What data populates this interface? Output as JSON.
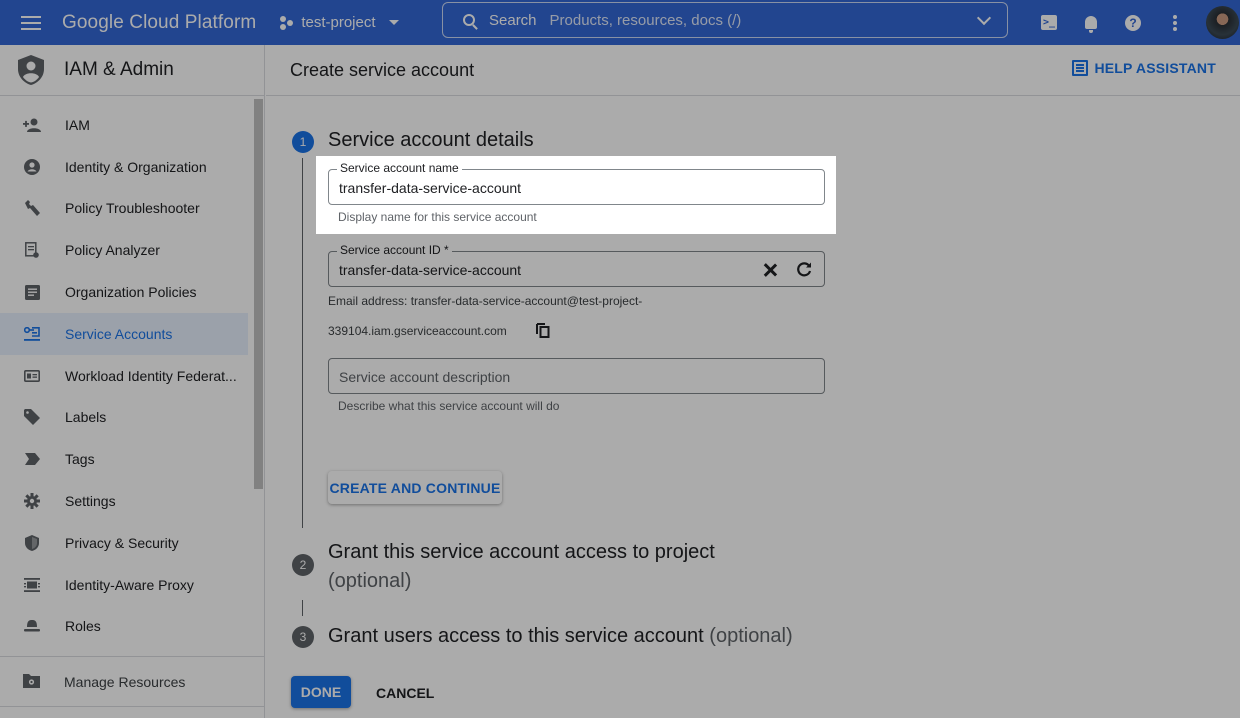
{
  "topbar": {
    "brand": "Google Cloud Platform",
    "project": "test-project",
    "search_label": "Search",
    "search_placeholder": "Products, resources, docs (/)",
    "icons": [
      "menu-icon",
      "project-icon",
      "search-icon",
      "chevron-down-icon",
      "cloud-shell-icon",
      "bell-icon",
      "help-icon",
      "more-vert-icon",
      "avatar"
    ],
    "accent": "#3367d6"
  },
  "sidebar": {
    "title": "IAM & Admin",
    "items": [
      {
        "label": "IAM",
        "icon": "person-add-icon"
      },
      {
        "label": "Identity & Organization",
        "icon": "account-circle-icon"
      },
      {
        "label": "Policy Troubleshooter",
        "icon": "wrench-icon"
      },
      {
        "label": "Policy Analyzer",
        "icon": "policy-doc-icon"
      },
      {
        "label": "Organization Policies",
        "icon": "article-icon"
      },
      {
        "label": "Service Accounts",
        "icon": "service-account-icon",
        "active": true
      },
      {
        "label": "Workload Identity Federat...",
        "icon": "id-card-icon"
      },
      {
        "label": "Labels",
        "icon": "label-tag-icon"
      },
      {
        "label": "Tags",
        "icon": "tag-arrow-icon"
      },
      {
        "label": "Settings",
        "icon": "gear-icon"
      },
      {
        "label": "Privacy & Security",
        "icon": "shield-icon"
      },
      {
        "label": "Identity-Aware Proxy",
        "icon": "iap-icon"
      },
      {
        "label": "Roles",
        "icon": "hat-icon"
      }
    ],
    "bottom_item": {
      "label": "Manage Resources",
      "icon": "folder-gear-icon"
    }
  },
  "page": {
    "title": "Create service account",
    "help_assistant": "HELP ASSISTANT"
  },
  "steps": [
    {
      "number": "1",
      "title": "Service account details",
      "status": "active"
    },
    {
      "number": "2",
      "title": "Grant this service account access to project",
      "optional": "(optional)",
      "status": "inactive"
    },
    {
      "number": "3",
      "title": "Grant users access to this service account",
      "optional": "(optional)",
      "status": "inactive"
    }
  ],
  "form": {
    "name_label": "Service account name",
    "name_value": "transfer-data-service-account",
    "name_hint": "Display name for this service account",
    "id_label": "Service account ID *",
    "id_value": "transfer-data-service-account",
    "email_line1": "Email address: transfer-data-service-account@test-project-",
    "email_line2": "339104.iam.gserviceaccount.com",
    "description_placeholder": "Service account description",
    "description_hint": "Describe what this service account will do",
    "create_button": "CREATE AND CONTINUE"
  },
  "actions": {
    "done": "DONE",
    "cancel": "CANCEL"
  },
  "colors": {
    "primary": "#1a73e8",
    "overlay": "rgba(0,0,0,0.33)"
  }
}
